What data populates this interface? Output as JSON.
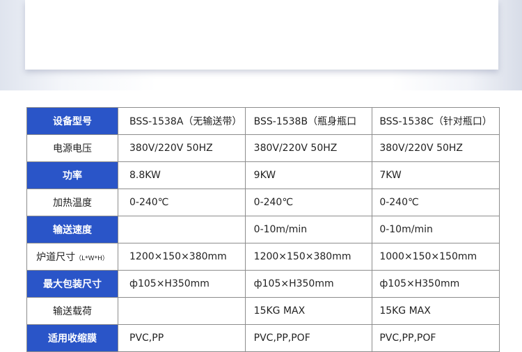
{
  "table": {
    "rows": [
      {
        "label": "设备型号",
        "values": [
          "BSS-1538A（无输送带）",
          "BSS-1538B（瓶身瓶口",
          "BSS-1538C（针对瓶口）"
        ]
      },
      {
        "label": "电源电压",
        "values": [
          "380V/220V 50HZ",
          "380V/220V 50HZ",
          "380V/220V 50HZ"
        ]
      },
      {
        "label": "功率",
        "values": [
          "8.8KW",
          "9KW",
          "7KW"
        ]
      },
      {
        "label": "加热温度",
        "values": [
          "0-240℃",
          "0-240℃",
          "0-240℃"
        ]
      },
      {
        "label": "输送速度",
        "values": [
          "",
          "0-10m/min",
          "0-10m/min"
        ]
      },
      {
        "label": "炉道尺寸",
        "label_unit": "（L*W*H）",
        "values": [
          "1200×150×380mm",
          "1200×150×380mm",
          "1000×150×150mm"
        ]
      },
      {
        "label": "最大包装尺寸",
        "values": [
          "ф105×H350mm",
          "ф105×H350mm",
          "ф105×H350mm"
        ]
      },
      {
        "label": "输送载荷",
        "values": [
          "",
          "15KG MAX",
          "15KG MAX"
        ]
      },
      {
        "label": "适用收缩膜",
        "values": [
          "PVC,PP",
          "PVC,PP,POF",
          "PVC,PP,POF"
        ]
      }
    ]
  },
  "colors": {
    "label_blue": "#2a55c8",
    "border": "#8c8c8c"
  }
}
